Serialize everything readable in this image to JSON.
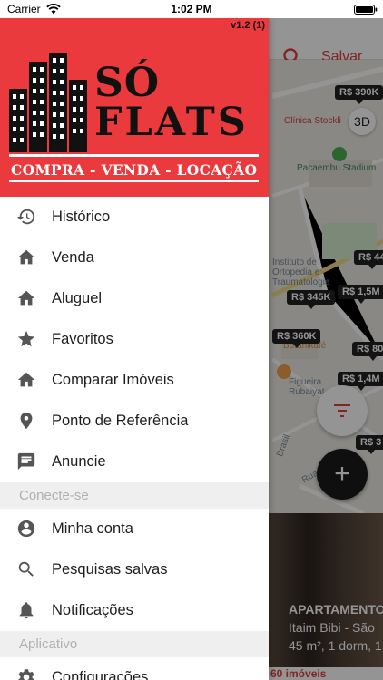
{
  "status_bar": {
    "carrier": "Carrier",
    "time": "1:02 PM"
  },
  "drawer": {
    "version": "v1.2 (1)",
    "brand": {
      "main": "SÓ",
      "sub": "FLATS",
      "tagline": "COMPRA - VENDA - LOCAÇÃO"
    },
    "items_main": [
      {
        "label": "Histórico",
        "icon": "history-icon"
      },
      {
        "label": "Venda",
        "icon": "home-icon"
      },
      {
        "label": "Aluguel",
        "icon": "home-icon"
      },
      {
        "label": "Favoritos",
        "icon": "star-icon"
      },
      {
        "label": "Comparar Imóveis",
        "icon": "home-icon"
      },
      {
        "label": "Ponto de Referência",
        "icon": "location-pin-icon"
      },
      {
        "label": "Anuncie",
        "icon": "chat-icon"
      }
    ],
    "section_account": "Conecte-se",
    "items_account": [
      {
        "label": "Minha conta",
        "icon": "account-icon"
      },
      {
        "label": "Pesquisas salvas",
        "icon": "search-icon"
      },
      {
        "label": "Notificações",
        "icon": "bell-icon"
      }
    ],
    "section_app": "Aplicativo",
    "items_app": [
      {
        "label": "Configurações",
        "icon": "gear-icon"
      }
    ]
  },
  "background": {
    "salvar": "Salvar",
    "btn_3d": "3D",
    "map_labels": [
      "Clínica Stockli",
      "Pacaembu Stadium",
      "Instituto de Ortopedia e Traumatologia",
      "Botanikafé",
      "Figueira Rubaiyat",
      "Brasil",
      "Rua Canadá"
    ],
    "price_pins": [
      "R$ 390K",
      "R$ 44",
      "R$ 345K",
      "R$ 1,5M",
      "R$ 360K",
      "R$ 800",
      "R$ 1,4M",
      "R$ 3"
    ],
    "listing": {
      "title": "APARTAMENTO",
      "location": "Itaim Bibi - São",
      "details": "45 m², 1 dorm, 1"
    },
    "count": "60 imóveis"
  },
  "colors": {
    "brand_red": "#ea3a3d",
    "accent": "#e0403c",
    "icon_gray": "#555555"
  }
}
